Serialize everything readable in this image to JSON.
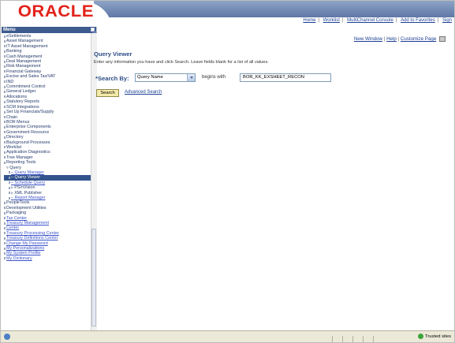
{
  "header": {
    "logo": "ORACLE",
    "links": [
      "Home",
      "Worklist",
      "MultiChannel Console",
      "Add to Favorites",
      "Sign"
    ]
  },
  "menu": {
    "title": "Menu",
    "items": [
      {
        "label": "eSettlements",
        "type": "folder"
      },
      {
        "label": "Asset Management",
        "type": "folder"
      },
      {
        "label": "IT Asset Management",
        "type": "folder"
      },
      {
        "label": "Banking",
        "type": "folder"
      },
      {
        "label": "Cash Management",
        "type": "folder"
      },
      {
        "label": "Deal Management",
        "type": "folder"
      },
      {
        "label": "Risk Management",
        "type": "folder"
      },
      {
        "label": "Financial Gateway",
        "type": "folder"
      },
      {
        "label": "Excise and Sales Tax/VAT",
        "type": "folder"
      },
      {
        "label": "IND",
        "type": "folder"
      },
      {
        "label": "Commitment Control",
        "type": "folder"
      },
      {
        "label": "General Ledger",
        "type": "folder"
      },
      {
        "label": "Allocations",
        "type": "folder"
      },
      {
        "label": "Statutory Reports",
        "type": "folder"
      },
      {
        "label": "SCM Integrations",
        "type": "folder"
      },
      {
        "label": "Set Up Financials/Supply",
        "type": "folder"
      },
      {
        "label": "Chain",
        "type": "folder"
      },
      {
        "label": "BOR Menus",
        "type": "folder"
      },
      {
        "label": "Enterprise Components",
        "type": "folder"
      },
      {
        "label": "Government Resource",
        "type": "folder"
      },
      {
        "label": "Directory",
        "type": "folder"
      },
      {
        "label": "Background Processes",
        "type": "folder"
      },
      {
        "label": "Worklist",
        "type": "folder"
      },
      {
        "label": "Application Diagnostics",
        "type": "folder"
      },
      {
        "label": "Tree Manager",
        "type": "folder"
      },
      {
        "label": "Reporting Tools",
        "type": "folder"
      },
      {
        "label": "▿ Query",
        "type": "open"
      },
      {
        "label": "– Query Manager",
        "type": "sublink"
      },
      {
        "label": "– Query Viewer",
        "type": "selected"
      },
      {
        "label": "– Schedule Query",
        "type": "sublink"
      },
      {
        "label": "▹ PS/nVision",
        "type": "sub"
      },
      {
        "label": "▹ XML Publisher",
        "type": "sub"
      },
      {
        "label": "– Report Manager",
        "type": "sublink"
      },
      {
        "label": "PeopleTools",
        "type": "folder"
      },
      {
        "label": "Development Utilities",
        "type": "folder"
      },
      {
        "label": "Packaging",
        "type": "folder"
      },
      {
        "label": "Tax Center",
        "type": "link"
      },
      {
        "label": "Treasury Management",
        "type": "link"
      },
      {
        "label": "Center",
        "type": "link"
      },
      {
        "label": "Treasury Processing Center",
        "type": "link"
      },
      {
        "label": "Treasury Definitions Center",
        "type": "link"
      },
      {
        "label": "Change My Password",
        "type": "link"
      },
      {
        "label": "My Personalizations",
        "type": "link"
      },
      {
        "label": "My System Profile",
        "type": "link"
      },
      {
        "label": "My Dictionary",
        "type": "link"
      }
    ]
  },
  "main": {
    "toplinks": [
      "New Window",
      "Help",
      "Customize Page"
    ],
    "title": "Query Viewer",
    "instructions": "Enter any information you have and click Search. Leave fields blank for a list of all values.",
    "search_by_label": "*Search By:",
    "search_by_value": "Query Name",
    "operator": "begins with",
    "search_value": "BOR_KK_EXSHEET_RECON",
    "search_button": "Search",
    "advanced_search": "Advanced Search"
  },
  "status": {
    "zone": "Trusted sites"
  }
}
